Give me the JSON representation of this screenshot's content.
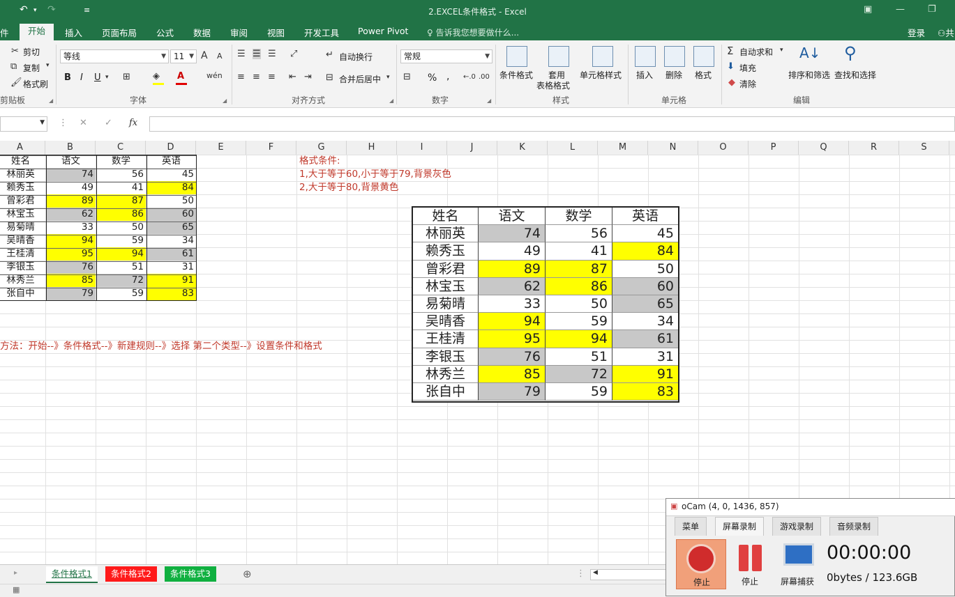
{
  "window": {
    "title": "2.EXCEL条件格式 - Excel"
  },
  "ribbon_tabs": [
    {
      "id": "file",
      "label": "件"
    },
    {
      "id": "home",
      "label": "开始"
    },
    {
      "id": "insert",
      "label": "插入"
    },
    {
      "id": "layout",
      "label": "页面布局"
    },
    {
      "id": "formulas",
      "label": "公式"
    },
    {
      "id": "data",
      "label": "数据"
    },
    {
      "id": "review",
      "label": "审阅"
    },
    {
      "id": "view",
      "label": "视图"
    },
    {
      "id": "developer",
      "label": "开发工具"
    },
    {
      "id": "powerpivot",
      "label": "Power Pivot"
    }
  ],
  "tell_me": "告诉我您想要做什么...",
  "account": {
    "login": "登录",
    "share": "共"
  },
  "ribbon": {
    "clipboard": {
      "cut": "剪切",
      "copy": "复制",
      "format_painter": "格式刷",
      "group": "剪贴板"
    },
    "font": {
      "name": "等线",
      "size": "11",
      "group": "字体",
      "bold": "B",
      "italic": "I",
      "underline": "U"
    },
    "alignment": {
      "wrap": "自动换行",
      "merge": "合并后居中",
      "group": "对齐方式"
    },
    "number": {
      "format": "常规",
      "percent": "%",
      "comma": ",",
      "group": "数字"
    },
    "styles": {
      "conditional": "条件格式",
      "table": "套用",
      "table2": "表格格式",
      "cell_styles": "单元格样式",
      "group": "样式"
    },
    "cells": {
      "insert": "插入",
      "delete": "删除",
      "format": "格式",
      "group": "单元格"
    },
    "editing": {
      "autosum": "自动求和",
      "fill": "填充",
      "clear": "清除",
      "sort": "排序和筛选",
      "find": "查找和选择",
      "group": "编辑"
    }
  },
  "formula_bar": {
    "fx": "fx",
    "value": ""
  },
  "columns": [
    "A",
    "B",
    "C",
    "D",
    "E",
    "F",
    "G",
    "H",
    "I",
    "J",
    "K",
    "L",
    "M",
    "N",
    "O",
    "P",
    "Q",
    "R",
    "S"
  ],
  "table": {
    "headers": [
      "姓名",
      "语文",
      "数学",
      "英语"
    ],
    "rows": [
      {
        "name": "林丽英",
        "values": [
          74,
          56,
          45
        ],
        "fills": [
          "gray",
          "none",
          "none"
        ]
      },
      {
        "name": "赖秀玉",
        "values": [
          49,
          41,
          84
        ],
        "fills": [
          "none",
          "none",
          "yellow"
        ]
      },
      {
        "name": "曾彩君",
        "values": [
          89,
          87,
          50
        ],
        "fills": [
          "yellow",
          "yellow",
          "none"
        ]
      },
      {
        "name": "林宝玉",
        "values": [
          62,
          86,
          60
        ],
        "fills": [
          "gray",
          "yellow",
          "gray"
        ]
      },
      {
        "name": "易菊晴",
        "values": [
          33,
          50,
          65
        ],
        "fills": [
          "none",
          "none",
          "gray"
        ]
      },
      {
        "name": "吴晴香",
        "values": [
          94,
          59,
          34
        ],
        "fills": [
          "yellow",
          "none",
          "none"
        ]
      },
      {
        "name": "王桂清",
        "values": [
          95,
          94,
          61
        ],
        "fills": [
          "yellow",
          "yellow",
          "gray"
        ]
      },
      {
        "name": "李银玉",
        "values": [
          76,
          51,
          31
        ],
        "fills": [
          "gray",
          "none",
          "none"
        ]
      },
      {
        "name": "林秀兰",
        "values": [
          85,
          72,
          91
        ],
        "fills": [
          "yellow",
          "gray",
          "yellow"
        ]
      },
      {
        "name": "张自中",
        "values": [
          79,
          59,
          83
        ],
        "fills": [
          "gray",
          "none",
          "yellow"
        ]
      }
    ]
  },
  "notes": {
    "title": "格式条件:",
    "rule1": "1,大于等于60,小于等于79,背景灰色",
    "rule2": "2,大于等于80,背景黄色",
    "method": "方法：开始--》条件格式--》新建规则--》选择 第二个类型--》设置条件和格式"
  },
  "colors": {
    "excel_green": "#217346",
    "gray_fill": "#c8c8c8",
    "yellow_fill": "#ffff00",
    "note_red": "#c0392b"
  },
  "sheets": [
    {
      "label": "条件格式1",
      "active": true,
      "color": "#ffffff"
    },
    {
      "label": "条件格式2",
      "active": false,
      "color": "#ff1a1a"
    },
    {
      "label": "条件格式3",
      "active": false,
      "color": "#10b040"
    }
  ],
  "ocam": {
    "title": "oCam (4, 0, 1436, 857)",
    "tabs": [
      "菜单",
      "屏幕录制",
      "游戏录制",
      "音频录制"
    ],
    "stop_label": "停止",
    "pause_label": "停止",
    "capture_label": "屏幕捕获",
    "timer": "00:00:00",
    "size": "0bytes / 123.6GB"
  }
}
